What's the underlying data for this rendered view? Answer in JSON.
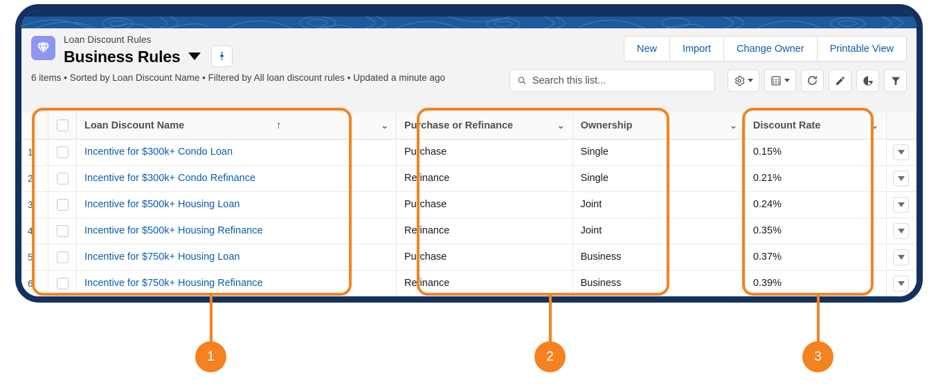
{
  "header": {
    "object_name": "Loan Discount Rules",
    "list_title": "Business Rules",
    "app_icon": "diamond-icon",
    "title_chevron_icon": "chevron-down-icon",
    "pin_icon": "pin-icon",
    "meta": "6 items • Sorted by Loan Discount Name • Filtered by All loan discount rules • Updated a minute ago"
  },
  "actions": [
    {
      "label": "New",
      "name": "new-button"
    },
    {
      "label": "Import",
      "name": "import-button"
    },
    {
      "label": "Change Owner",
      "name": "change-owner-button"
    },
    {
      "label": "Printable View",
      "name": "printable-view-button"
    }
  ],
  "search": {
    "placeholder": "Search this list...",
    "value": "",
    "icon": "search-icon"
  },
  "toolbar_icons": [
    {
      "name": "list-view-controls-icon",
      "glyph": "gear",
      "has_caret": true
    },
    {
      "name": "display-as-icon",
      "glyph": "table",
      "has_caret": true
    },
    {
      "name": "refresh-icon",
      "glyph": "refresh",
      "has_caret": false
    },
    {
      "name": "edit-icon",
      "glyph": "pencil",
      "has_caret": false
    },
    {
      "name": "charts-icon",
      "glyph": "chart",
      "has_caret": false
    },
    {
      "name": "filter-icon",
      "glyph": "funnel",
      "has_caret": false
    }
  ],
  "table": {
    "columns": [
      {
        "label": "Loan Discount Name",
        "sorted": true,
        "sort_glyph": "↑",
        "caret": "⌄"
      },
      {
        "label": "Purchase or Refinance",
        "sorted": false,
        "caret": "⌄"
      },
      {
        "label": "Ownership",
        "sorted": false,
        "caret": "⌄"
      },
      {
        "label": "Discount Rate",
        "sorted": false,
        "caret": "⌄"
      }
    ],
    "rows": [
      {
        "num": "1",
        "name": "Incentive for $300k+ Condo Loan",
        "purchase_or_refinance": "Purchase",
        "ownership": "Single",
        "discount_rate": "0.15%"
      },
      {
        "num": "2",
        "name": "Incentive for $300k+ Condo Refinance",
        "purchase_or_refinance": "Refinance",
        "ownership": "Single",
        "discount_rate": "0.21%"
      },
      {
        "num": "3",
        "name": "Incentive for $500k+ Housing Loan",
        "purchase_or_refinance": "Purchase",
        "ownership": "Joint",
        "discount_rate": "0.24%"
      },
      {
        "num": "4",
        "name": "Incentive for $500k+ Housing Refinance",
        "purchase_or_refinance": "Refinance",
        "ownership": "Joint",
        "discount_rate": "0.35%"
      },
      {
        "num": "5",
        "name": "Incentive for $750k+ Housing Loan",
        "purchase_or_refinance": "Purchase",
        "ownership": "Business",
        "discount_rate": "0.37%"
      },
      {
        "num": "6",
        "name": "Incentive for $750k+ Housing Refinance",
        "purchase_or_refinance": "Refinance",
        "ownership": "Business",
        "discount_rate": "0.39%"
      }
    ]
  },
  "callouts": [
    {
      "number": "1"
    },
    {
      "number": "2"
    },
    {
      "number": "3"
    }
  ],
  "colors": {
    "accent_orange": "#f58220",
    "frame_navy": "#13315f",
    "link_blue": "#0b5cab",
    "app_icon_purple": "#8f96ef",
    "banner_blue": "#1b5a9e"
  }
}
